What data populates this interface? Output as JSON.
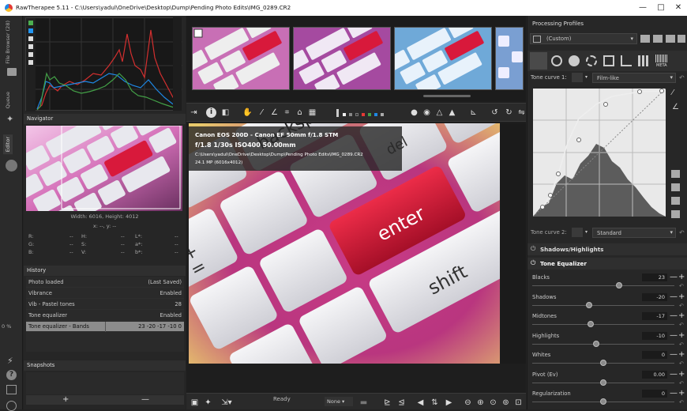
{
  "window": {
    "title": "RawTherapee 5.11 - C:\\Users\\yadul\\OneDrive\\Desktop\\Dump\\Pending Photo Edits\\IMG_0289.CR2",
    "minimize": "—",
    "maximize": "□",
    "close": "✕"
  },
  "left_tabs": [
    "File Browser (28)",
    "Queue",
    "Editor"
  ],
  "navigator": {
    "title": "Navigator",
    "dimensions": "Width: 6016, Height: 4012",
    "coords": "x: --, y: --",
    "rows": [
      [
        "R:",
        "--",
        "H:",
        "--",
        "L*:",
        "--"
      ],
      [
        "G:",
        "--",
        "S:",
        "--",
        "a*:",
        "--"
      ],
      [
        "B:",
        "--",
        "V:",
        "--",
        "b*:",
        "--"
      ]
    ]
  },
  "history": {
    "title": "History",
    "items": [
      {
        "label": "Photo loaded",
        "value": "(Last Saved)"
      },
      {
        "label": "Vibrance",
        "value": "Enabled"
      },
      {
        "label": "Vib - Pastel tones",
        "value": "28"
      },
      {
        "label": "Tone equalizer",
        "value": "Enabled"
      },
      {
        "label": "Tone equalizer - Bands",
        "value": "23 -20 -17 -10 0"
      }
    ],
    "zoom_label": "0 %"
  },
  "snapshots": {
    "title": "Snapshots",
    "add": "+",
    "remove": "—"
  },
  "exif": {
    "camera": "Canon EOS 200D - Canon EF 50mm f/1.8 STM",
    "settings": "f/1.8  1/30s  ISO400  50.00mm",
    "path": "C:\\Users\\yadul\\OneDrive\\Desktop\\Dump\\Pending Photo Edits\\IMG_0289.CR2",
    "size": "24.1 MP (6016x4012)"
  },
  "status": {
    "text": "Ready",
    "none_select": "None"
  },
  "key_labels": {
    "backspace": "backspace",
    "enter": "enter",
    "shift": "shift",
    "del": "del",
    "en": "en",
    "plus": "+",
    "eq": "="
  },
  "processing": {
    "title": "Processing Profiles",
    "profile": "(Custom)",
    "tone_curve1": {
      "label": "Tone curve 1:",
      "value": "Film-like"
    },
    "tone_curve2": {
      "label": "Tone curve 2:",
      "value": "Standard"
    },
    "meta_label": "META",
    "shadows_highlights": "Shadows/Highlights",
    "tone_equalizer": "Tone Equalizer",
    "sliders": [
      {
        "label": "Blacks",
        "value": "23",
        "fraction": 0.61
      },
      {
        "label": "Shadows",
        "value": "-20",
        "fraction": 0.4
      },
      {
        "label": "Midtones",
        "value": "-17",
        "fraction": 0.41
      },
      {
        "label": "Highlights",
        "value": "-10",
        "fraction": 0.45
      },
      {
        "label": "Whites",
        "value": "0",
        "fraction": 0.5
      },
      {
        "label": "Pivot (Ev)",
        "value": "0.00",
        "fraction": 0.5
      },
      {
        "label": "Regularization",
        "value": "0",
        "fraction": 0.5
      }
    ]
  },
  "colors": {
    "accent_red": "#e01e3c",
    "panel": "#262626",
    "bg": "#1e1e1e"
  }
}
